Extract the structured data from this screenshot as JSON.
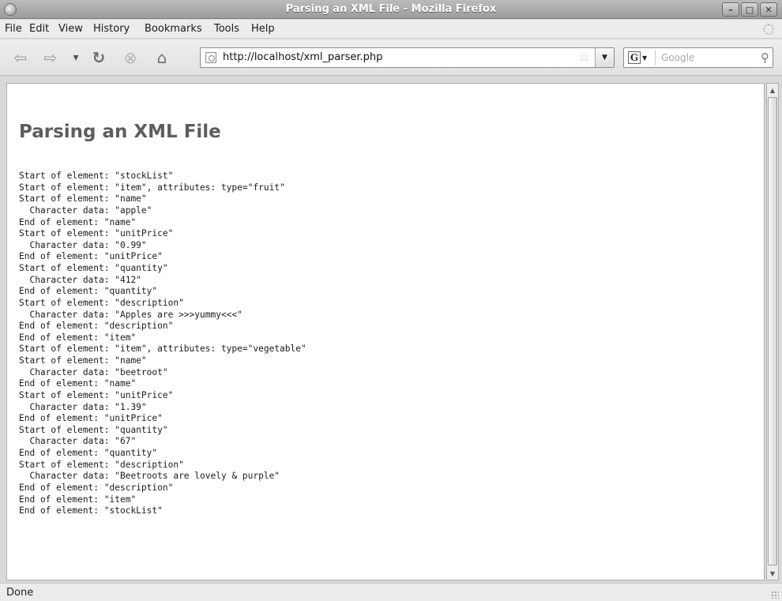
{
  "window": {
    "title": "Parsing an XML File - Mozilla Firefox",
    "buttons": {
      "minimize": "–",
      "maximize": "□",
      "close": "✕"
    }
  },
  "menu": {
    "items": [
      "File",
      "Edit",
      "View",
      "History",
      "Bookmarks",
      "Tools",
      "Help"
    ]
  },
  "toolbar": {
    "back": "⇦",
    "forward": "⇨",
    "history_dropdown": "▾",
    "reload": "↻",
    "stop": "⊗",
    "home": "⌂",
    "url": "http://localhost/xml_parser.php",
    "bookmark_star": "☆",
    "url_dropdown": "▼",
    "search_engine": "G",
    "search_engine_dropdown": "▼",
    "search_placeholder": "Google",
    "search_go": "⚲"
  },
  "page": {
    "heading": "Parsing an XML File",
    "log_lines": [
      "Start of element: \"stockList\"",
      "Start of element: \"item\", attributes: type=\"fruit\"",
      "Start of element: \"name\"",
      "  Character data: \"apple\"",
      "End of element: \"name\"",
      "Start of element: \"unitPrice\"",
      "  Character data: \"0.99\"",
      "End of element: \"unitPrice\"",
      "Start of element: \"quantity\"",
      "  Character data: \"412\"",
      "End of element: \"quantity\"",
      "Start of element: \"description\"",
      "  Character data: \"Apples are >>>yummy<<<\"",
      "End of element: \"description\"",
      "End of element: \"item\"",
      "Start of element: \"item\", attributes: type=\"vegetable\"",
      "Start of element: \"name\"",
      "  Character data: \"beetroot\"",
      "End of element: \"name\"",
      "Start of element: \"unitPrice\"",
      "  Character data: \"1.39\"",
      "End of element: \"unitPrice\"",
      "Start of element: \"quantity\"",
      "  Character data: \"67\"",
      "End of element: \"quantity\"",
      "Start of element: \"description\"",
      "  Character data: \"Beetroots are lovely & purple\"",
      "End of element: \"description\"",
      "End of element: \"item\"",
      "End of element: \"stockList\""
    ]
  },
  "scrollbar": {
    "up": "▲",
    "down": "▼"
  },
  "status": {
    "text": "Done"
  }
}
